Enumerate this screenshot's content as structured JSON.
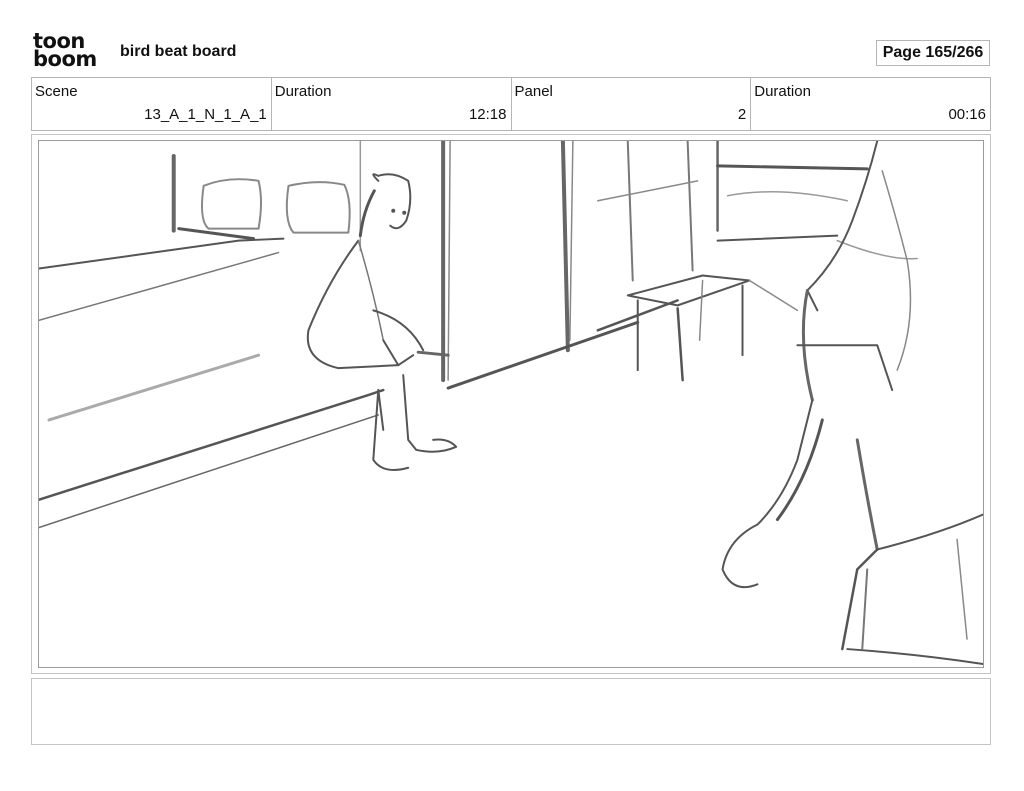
{
  "header": {
    "logo_line1": "toon",
    "logo_line2": "boom",
    "project_title": "bird beat board",
    "page_indicator": "Page 165/266"
  },
  "info": {
    "scene_label": "Scene",
    "scene_value": "13_A_1_N_1_A_1",
    "scene_duration_label": "Duration",
    "scene_duration_value": "12:18",
    "panel_label": "Panel",
    "panel_value": "2",
    "panel_duration_label": "Duration",
    "panel_duration_value": "00:16"
  },
  "panel": {
    "image_icon": "pencil-sketch-bedroom"
  },
  "notes": {
    "text": ""
  }
}
